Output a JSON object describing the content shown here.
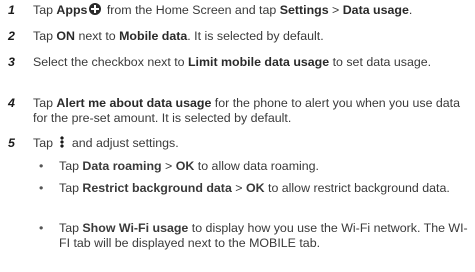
{
  "steps": [
    {
      "number": "1",
      "parts": {
        "t1": "Tap ",
        "apps": "Apps",
        "t2": " from the Home Screen and tap ",
        "settings": "Settings",
        "sep": " > ",
        "data_usage": "Data usage",
        "end": "."
      }
    },
    {
      "number": "2",
      "parts": {
        "t1": "Tap ",
        "on": "ON",
        "t2": " next to ",
        "mobile_data": "Mobile data",
        "t3": ". It is selected by default."
      }
    },
    {
      "number": "3",
      "parts": {
        "t1": "Select the checkbox next to ",
        "limit": "Limit mobile data usage",
        "t2": " to set data usage."
      }
    },
    {
      "number": "4",
      "parts": {
        "t1": "Tap ",
        "alert": "Alert me about data usage",
        "t2": " for the phone to alert you when you use data for the pre-set amount. It is selected by default."
      }
    },
    {
      "number": "5",
      "parts": {
        "t1": "Tap ",
        "t2": " and adjust settings."
      }
    }
  ],
  "subitems": [
    {
      "bullet": "•",
      "t1": "Tap ",
      "b1": "Data roaming",
      "sep": " > ",
      "b2": "OK",
      "t2": " to allow data roaming."
    },
    {
      "bullet": "•",
      "t1": "Tap ",
      "b1": "Restrict background data",
      "sep": " > ",
      "b2": "OK",
      "t2": " to allow restrict background data."
    },
    {
      "bullet": "•",
      "t1": "Tap ",
      "b1": "Show Wi-Fi usage",
      "t2": " to display how you use the Wi-Fi network. The WI-FI tab will be displayed next to the MOBILE tab."
    }
  ],
  "icons": {
    "apps": "apps-grid-icon",
    "menu": "more-options-icon"
  }
}
